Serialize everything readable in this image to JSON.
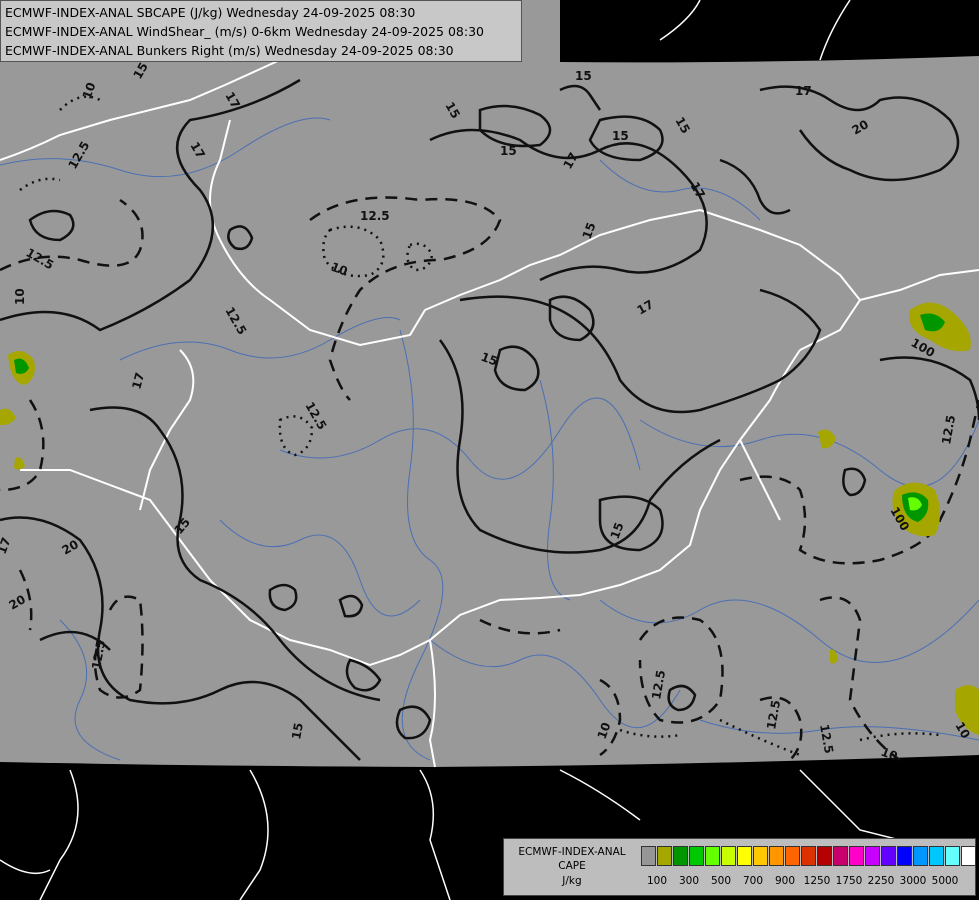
{
  "titles": {
    "line1": "ECMWF-INDEX-ANAL SBCAPE (J/kg) Wednesday 24-09-2025 08:30",
    "line2": "ECMWF-INDEX-ANAL WindShear_ (m/s) 0-6km Wednesday 24-09-2025 08:30",
    "line3": "ECMWF-INDEX-ANAL Bunkers Right (m/s) Wednesday 24-09-2025 08:30"
  },
  "contour_labels": [
    "10",
    "12.5",
    "15",
    "17",
    "20",
    "100"
  ],
  "legend": {
    "title1": "ECMWF-INDEX-ANAL",
    "title2": "CAPE",
    "unit": "J/kg",
    "colors": [
      "#969696",
      "#a6a600",
      "#009600",
      "#00c800",
      "#64ff00",
      "#c8ff00",
      "#ffff00",
      "#ffc800",
      "#ff9600",
      "#ff6400",
      "#dc3200",
      "#b40000",
      "#c8006e",
      "#ff00c8",
      "#c800ff",
      "#6400ff",
      "#0000ff",
      "#0096ff",
      "#00c8ff",
      "#64ffff",
      "#ffffff"
    ],
    "ticks": [
      "100",
      "300",
      "500",
      "700",
      "900",
      "1250",
      "1750",
      "2250",
      "3000",
      "5000"
    ]
  },
  "colors": {
    "background": "#000000",
    "field": "#999999",
    "borders": "#ffffff",
    "rivers": "#4b6fb4",
    "contours": "#000000"
  }
}
